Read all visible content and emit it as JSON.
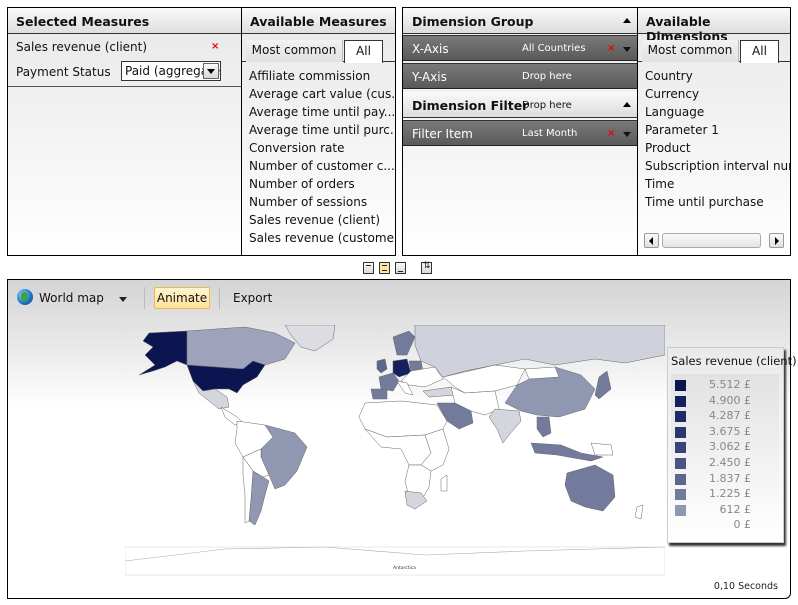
{
  "selected_measures": {
    "title": "Selected Measures",
    "items": [
      {
        "label": "Sales revenue (client)",
        "removable": true
      }
    ],
    "payment_status": {
      "label": "Payment Status",
      "value": "Paid (aggregated)"
    }
  },
  "available_measures": {
    "title": "Available Measures",
    "tabs": [
      {
        "label": "Most common",
        "active": false
      },
      {
        "label": "All",
        "active": true
      }
    ],
    "items": [
      "Affiliate commission",
      "Average cart value (cus...",
      "Average time until pay...",
      "Average time until purc...",
      "Conversion rate",
      "Number of customer c...",
      "Number of orders",
      "Number of sessions",
      "Sales revenue (client)",
      "Sales revenue (customer)"
    ]
  },
  "dimension_group": {
    "title": "Dimension Group",
    "x_axis": {
      "label": "X-Axis",
      "value": "All Countries"
    },
    "y_axis": {
      "label": "Y-Axis",
      "value": "Drop here"
    },
    "filter": {
      "title": "Dimension Filter",
      "value": "Drop here"
    },
    "filter_item": {
      "label": "Filter Item",
      "value": "Last Month"
    }
  },
  "available_dimensions": {
    "title": "Available Dimensions",
    "tabs": [
      {
        "label": "Most common",
        "active": false
      },
      {
        "label": "All",
        "active": true
      }
    ],
    "items": [
      "Country",
      "Currency",
      "Language",
      "Parameter 1",
      "Product",
      "Subscription interval number",
      "Time",
      "Time until purchase"
    ]
  },
  "layout_toggles": [
    {
      "name": "layout-top",
      "active": false
    },
    {
      "name": "layout-middle",
      "active": true
    },
    {
      "name": "layout-bottom",
      "active": false
    },
    {
      "name": "swap-layout",
      "active": false
    }
  ],
  "map_panel": {
    "view_selector": "World map",
    "animate_label": "Animate",
    "export_label": "Export",
    "elapsed": "0,10 Seconds",
    "antarctica_label": "Antarctica"
  },
  "chart_data": {
    "type": "heatmap",
    "subtype": "choropleth-world-map",
    "title": "Sales revenue (client)",
    "legend": {
      "title": "Sales revenue (client)",
      "placement": "right",
      "bins": [
        {
          "label": "5.512 £",
          "value": 5512,
          "color": "#0b1650"
        },
        {
          "label": "4.900 £",
          "value": 4900,
          "color": "#15205c"
        },
        {
          "label": "4.287 £",
          "value": 4287,
          "color": "#1f2a66"
        },
        {
          "label": "3.675 £",
          "value": 3675,
          "color": "#2c376f"
        },
        {
          "label": "3.062 £",
          "value": 3062,
          "color": "#3a4479"
        },
        {
          "label": "2.450 £",
          "value": 2450,
          "color": "#4a5383"
        },
        {
          "label": "1.837 £",
          "value": 1837,
          "color": "#5d668f"
        },
        {
          "label": "1.225 £",
          "value": 1225,
          "color": "#737b9d"
        },
        {
          "label": "612 £",
          "value": 612,
          "color": "#9097b1"
        },
        {
          "label": "0 £",
          "value": 0,
          "color": null
        }
      ]
    },
    "regions": [
      {
        "name": "United States",
        "bin": 0
      },
      {
        "name": "Alaska",
        "bin": 0
      },
      {
        "name": "Germany",
        "bin": 1
      },
      {
        "name": "United Kingdom",
        "bin": 6
      },
      {
        "name": "France",
        "bin": 7
      },
      {
        "name": "Canada",
        "bin": 7
      },
      {
        "name": "Australia",
        "bin": 7
      },
      {
        "name": "Saudi Arabia",
        "bin": 7
      },
      {
        "name": "Sweden",
        "bin": 7
      },
      {
        "name": "Poland",
        "bin": 7
      },
      {
        "name": "Japan",
        "bin": 7
      },
      {
        "name": "Argentina",
        "bin": 8
      },
      {
        "name": "China",
        "bin": 8
      },
      {
        "name": "Russia",
        "bin": 8
      },
      {
        "name": "Brazil",
        "bin": 8
      },
      {
        "name": "India",
        "bin": 8
      },
      {
        "name": "Mexico",
        "bin": 8
      },
      {
        "name": "South Africa",
        "bin": 8
      },
      {
        "name": "Indonesia",
        "bin": 7
      },
      {
        "name": "Spain",
        "bin": 7
      },
      {
        "name": "Turkey",
        "bin": 8
      },
      {
        "name": "Thailand",
        "bin": 7
      }
    ]
  }
}
